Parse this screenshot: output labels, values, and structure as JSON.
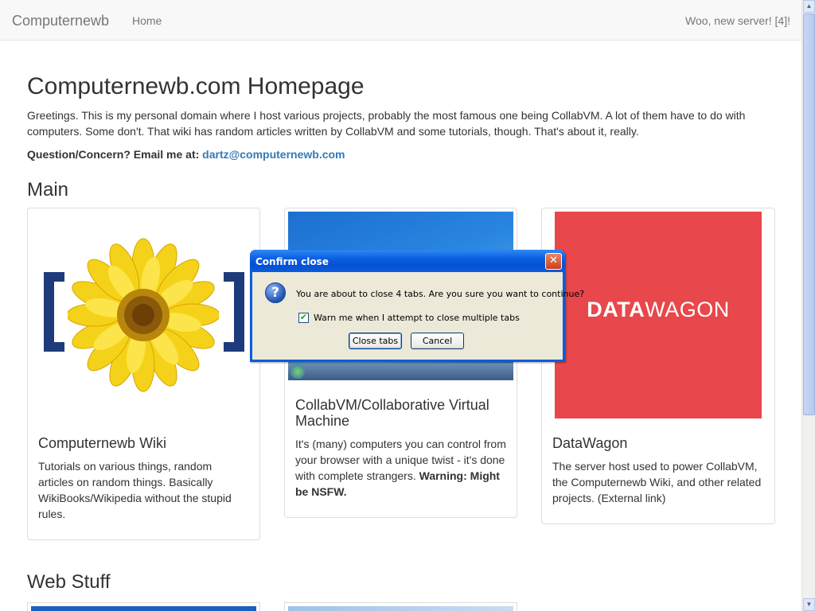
{
  "navbar": {
    "brand": "Computernewb",
    "home": "Home",
    "right_text": "Woo, new server! [4]!"
  },
  "page": {
    "title": "Computernewb.com Homepage",
    "intro": "Greetings. This is my personal domain where I host various projects, probably the most famous one being CollabVM. A lot of them have to do with computers. Some don't. That wiki has random articles written by CollabVM and some tutorials, though. That's about it, really.",
    "contact_label": "Question/Concern? Email me at:",
    "contact_email": "dartz@computernewb.com"
  },
  "sections": {
    "main": "Main",
    "web_stuff": "Web Stuff"
  },
  "cards": [
    {
      "title": "Computernewb Wiki",
      "text": "Tutorials on various things, random articles on random things. Basically WikiBooks/Wikipedia without the stupid rules."
    },
    {
      "title": "CollabVM/Collaborative Virtual Machine",
      "text": "It's (many) computers you can control from your browser with a unique twist - it's done with complete strangers.",
      "warning": "Warning: Might be NSFW."
    },
    {
      "title": "DataWagon",
      "logo_bold": "DATA",
      "logo_light": "WAGON",
      "text": "The server host used to power CollabVM, the Computernewb Wiki, and other related projects. (External link)"
    }
  ],
  "dialog": {
    "title": "Confirm close",
    "close_glyph": "✕",
    "icon_glyph": "?",
    "message": "You are about to close 4 tabs. Are you sure you want to continue?",
    "checkbox_label": "Warn me when I attempt to close multiple tabs",
    "checkbox_checked": true,
    "confirm_button": "Close tabs",
    "cancel_button": "Cancel"
  },
  "colors": {
    "link": "#337ab7",
    "datawagon_bg": "#e8474b",
    "xp_title_blue": "#0550d6"
  }
}
